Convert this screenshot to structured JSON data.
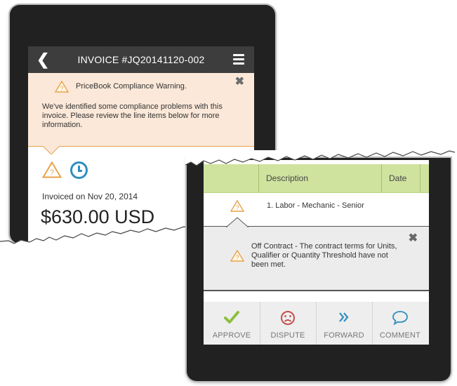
{
  "invoice_screen": {
    "header": {
      "back_icon": "chevron-left-icon",
      "title": "INVOICE #JQ20141120-002",
      "menu_icon": "hamburger-menu-icon"
    },
    "warning": {
      "heading": "PriceBook Compliance Warning.",
      "body": "We've identified some compliance problems with this invoice. Please review the line items below for more information.",
      "close_icon": "close-x-icon"
    },
    "status_icons": [
      "warning-triangle-icon",
      "clock-icon"
    ],
    "invoiced_date": "Invoiced on Nov 20, 2014",
    "amount": "$630.00 USD"
  },
  "line_items_screen": {
    "columns": [
      "Description",
      "Date"
    ],
    "rows": [
      {
        "description": "1. Labor - Mechanic - Senior",
        "icon": "warning-triangle-icon"
      }
    ],
    "detail": {
      "message": "Off Contract - The contract terms for Units, Qualifier or Quantity Threshold have not been met.",
      "close_icon": "close-x-icon"
    },
    "actions": [
      {
        "label": "APPROVE",
        "icon": "checkmark-icon"
      },
      {
        "label": "DISPUTE",
        "icon": "frown-face-icon"
      },
      {
        "label": "FORWARD",
        "icon": "double-chevron-right-icon"
      },
      {
        "label": "COMMENT",
        "icon": "speech-bubble-icon"
      }
    ]
  },
  "colors": {
    "header_bg": "#3d3d3d",
    "warning_bg": "#fbe8d8",
    "warning_accent": "#e9a24a",
    "table_header_bg": "#cfe39f",
    "approve_green": "#8cbf3f",
    "dispute_red": "#c0504d",
    "forward_blue": "#2f8fbf"
  }
}
